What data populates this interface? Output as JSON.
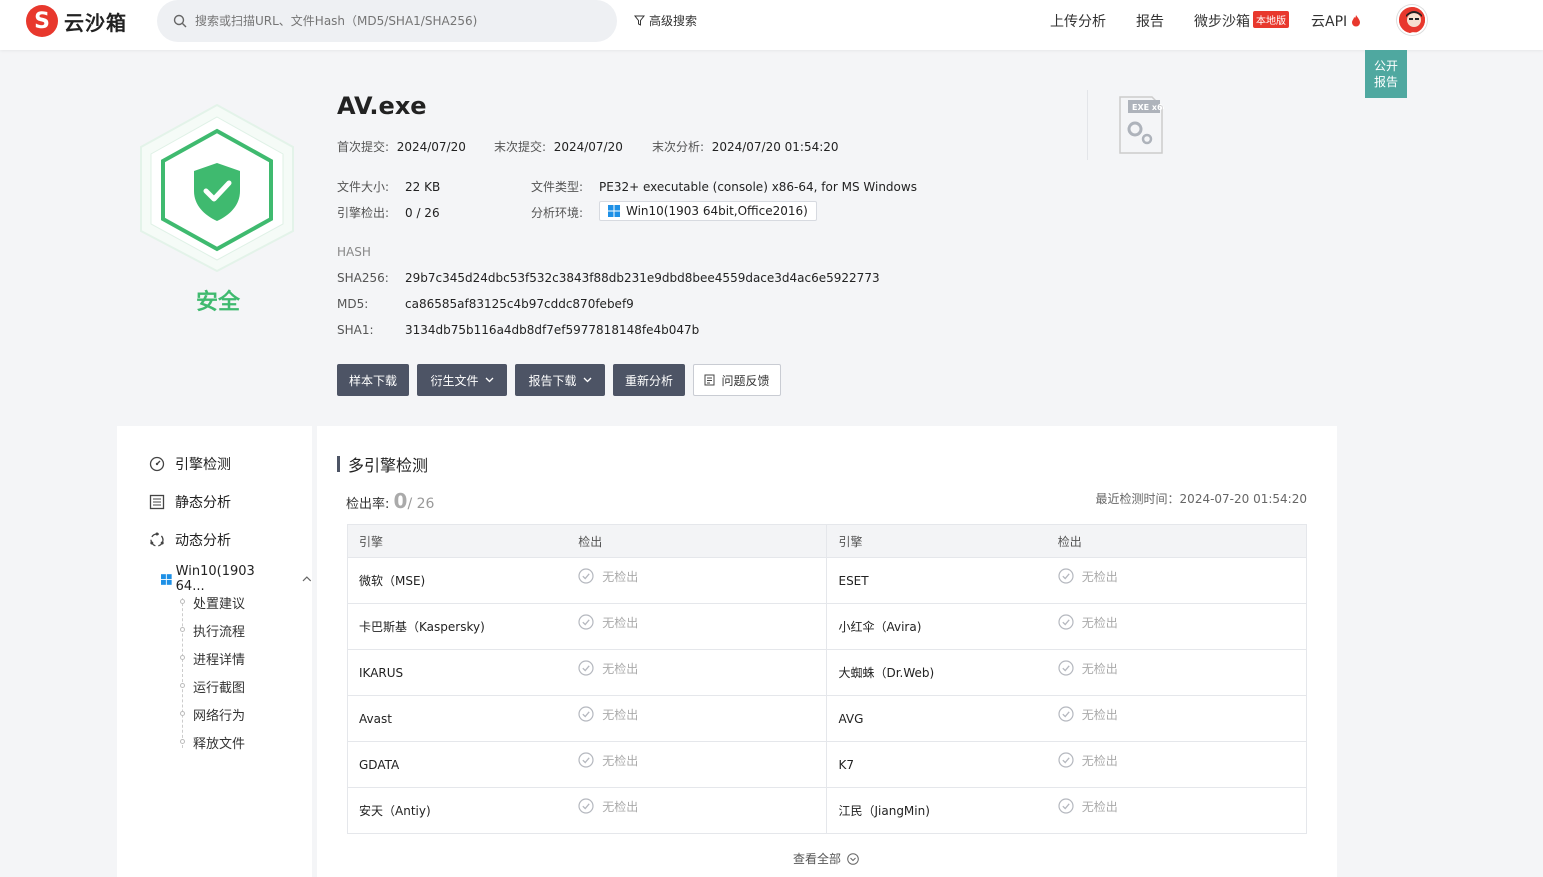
{
  "header": {
    "logo_text": "云沙箱",
    "search_placeholder": "搜索或扫描URL、文件Hash（MD5/SHA1/SHA256)",
    "advanced_search": "高级搜索",
    "nav": {
      "upload": "上传分析",
      "report": "报告",
      "local": "微步沙箱",
      "local_badge": "本地版",
      "api": "云API"
    }
  },
  "public_report": "公开报告",
  "verdict": {
    "label": "安全",
    "color": "#3fba6f"
  },
  "file": {
    "name": "AV.exe",
    "first_submit_label": "首次提交:",
    "first_submit": "2024/07/20",
    "last_submit_label": "末次提交:",
    "last_submit": "2024/07/20",
    "last_analysis_label": "末次分析:",
    "last_analysis": "2024/07/20 01:54:20",
    "size_label": "文件大小:",
    "size": "22 KB",
    "type_label": "文件类型:",
    "type": "PE32+ executable (console) x86-64, for MS Windows",
    "detect_label": "引擎检出:",
    "detect": "0 / 26",
    "env_label": "分析环境:",
    "env": "Win10(1903 64bit,Office2016)"
  },
  "hash": {
    "title": "HASH",
    "sha256_label": "SHA256:",
    "sha256": "29b7c345d24dbc53f532c3843f88db231e9dbd8bee4559dace3d4ac6e5922773",
    "md5_label": "MD5:",
    "md5": "ca86585af83125c4b97cddc870febef9",
    "sha1_label": "SHA1:",
    "sha1": "3134db75b116a4db8df7ef5977818148fe4b047b"
  },
  "actions": {
    "download_sample": "样本下载",
    "derived_files": "衍生文件",
    "download_report": "报告下载",
    "reanalyze": "重新分析",
    "feedback": "问题反馈"
  },
  "exe_icon_label": "EXE x64",
  "sidebar": {
    "engine": "引擎检测",
    "static": "静态分析",
    "dynamic": "动态分析",
    "env": "Win10(1903 64...",
    "sub": [
      "处置建议",
      "执行流程",
      "进程详情",
      "运行截图",
      "网络行为",
      "释放文件"
    ]
  },
  "engines": {
    "title": "多引擎检测",
    "rate_label": "检出率:",
    "rate_value": "0",
    "rate_total": "/ 26",
    "last_time": "最近检测时间：2024-07-20 01:54:20",
    "col_engine": "引擎",
    "col_result": "检出",
    "rows": [
      {
        "left": "微软（MSE)",
        "left_res": "无检出",
        "right": "ESET",
        "right_res": "无检出"
      },
      {
        "left": "卡巴斯基（Kaspersky)",
        "left_res": "无检出",
        "right": "小红伞（Avira)",
        "right_res": "无检出"
      },
      {
        "left": "IKARUS",
        "left_res": "无检出",
        "right": "大蜘蛛（Dr.Web)",
        "right_res": "无检出"
      },
      {
        "left": "Avast",
        "left_res": "无检出",
        "right": "AVG",
        "right_res": "无检出"
      },
      {
        "left": "GDATA",
        "left_res": "无检出",
        "right": "K7",
        "right_res": "无检出"
      },
      {
        "left": "安天（Antiy)",
        "left_res": "无检出",
        "right": "江民（JiangMin)",
        "right_res": "无检出"
      }
    ],
    "view_all": "查看全部"
  }
}
